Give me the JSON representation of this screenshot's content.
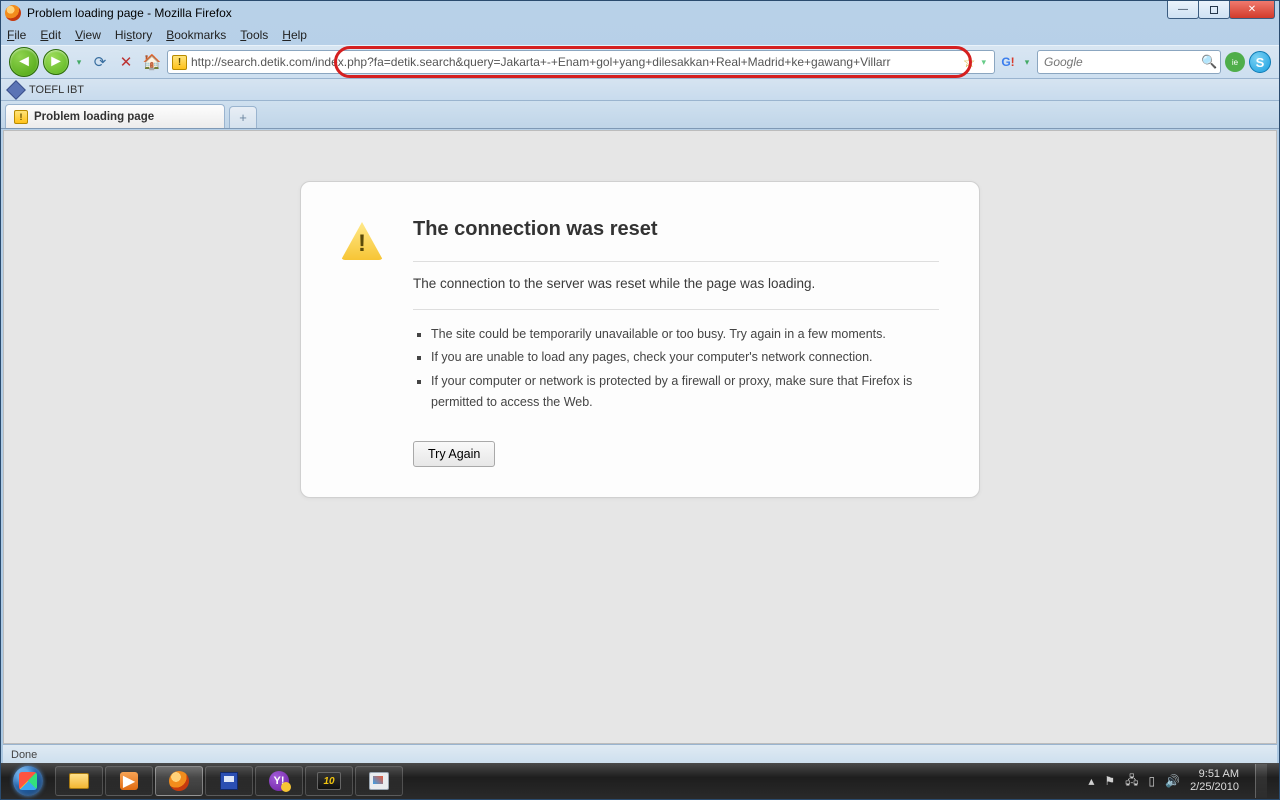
{
  "window": {
    "title": "Problem loading page - Mozilla Firefox"
  },
  "menu": {
    "file": "File",
    "edit": "Edit",
    "view": "View",
    "history": "History",
    "bookmarks": "Bookmarks",
    "tools": "Tools",
    "help": "Help"
  },
  "nav": {
    "url": "http://search.detik.com/index.php?fa=detik.search&query=Jakarta+-+Enam+gol+yang+dilesakkan+Real+Madrid+ke+gawang+Villarr",
    "search_placeholder": "Google"
  },
  "bookmarks_toolbar": {
    "item1": "TOEFL IBT"
  },
  "tabs": {
    "active_title": "Problem loading page"
  },
  "error": {
    "heading": "The connection was reset",
    "lead": "The connection to the server was reset while the page was loading.",
    "bullets": [
      "The site could be temporarily unavailable or too busy. Try again in a few moments.",
      "If you are unable to load any pages, check your computer's network connection.",
      "If your computer or network is protected by a firewall or proxy, make sure that Firefox is permitted to access the Web."
    ],
    "try_again": "Try Again"
  },
  "status": {
    "text": "Done"
  },
  "tray": {
    "time": "9:51 AM",
    "date": "2/25/2010"
  }
}
